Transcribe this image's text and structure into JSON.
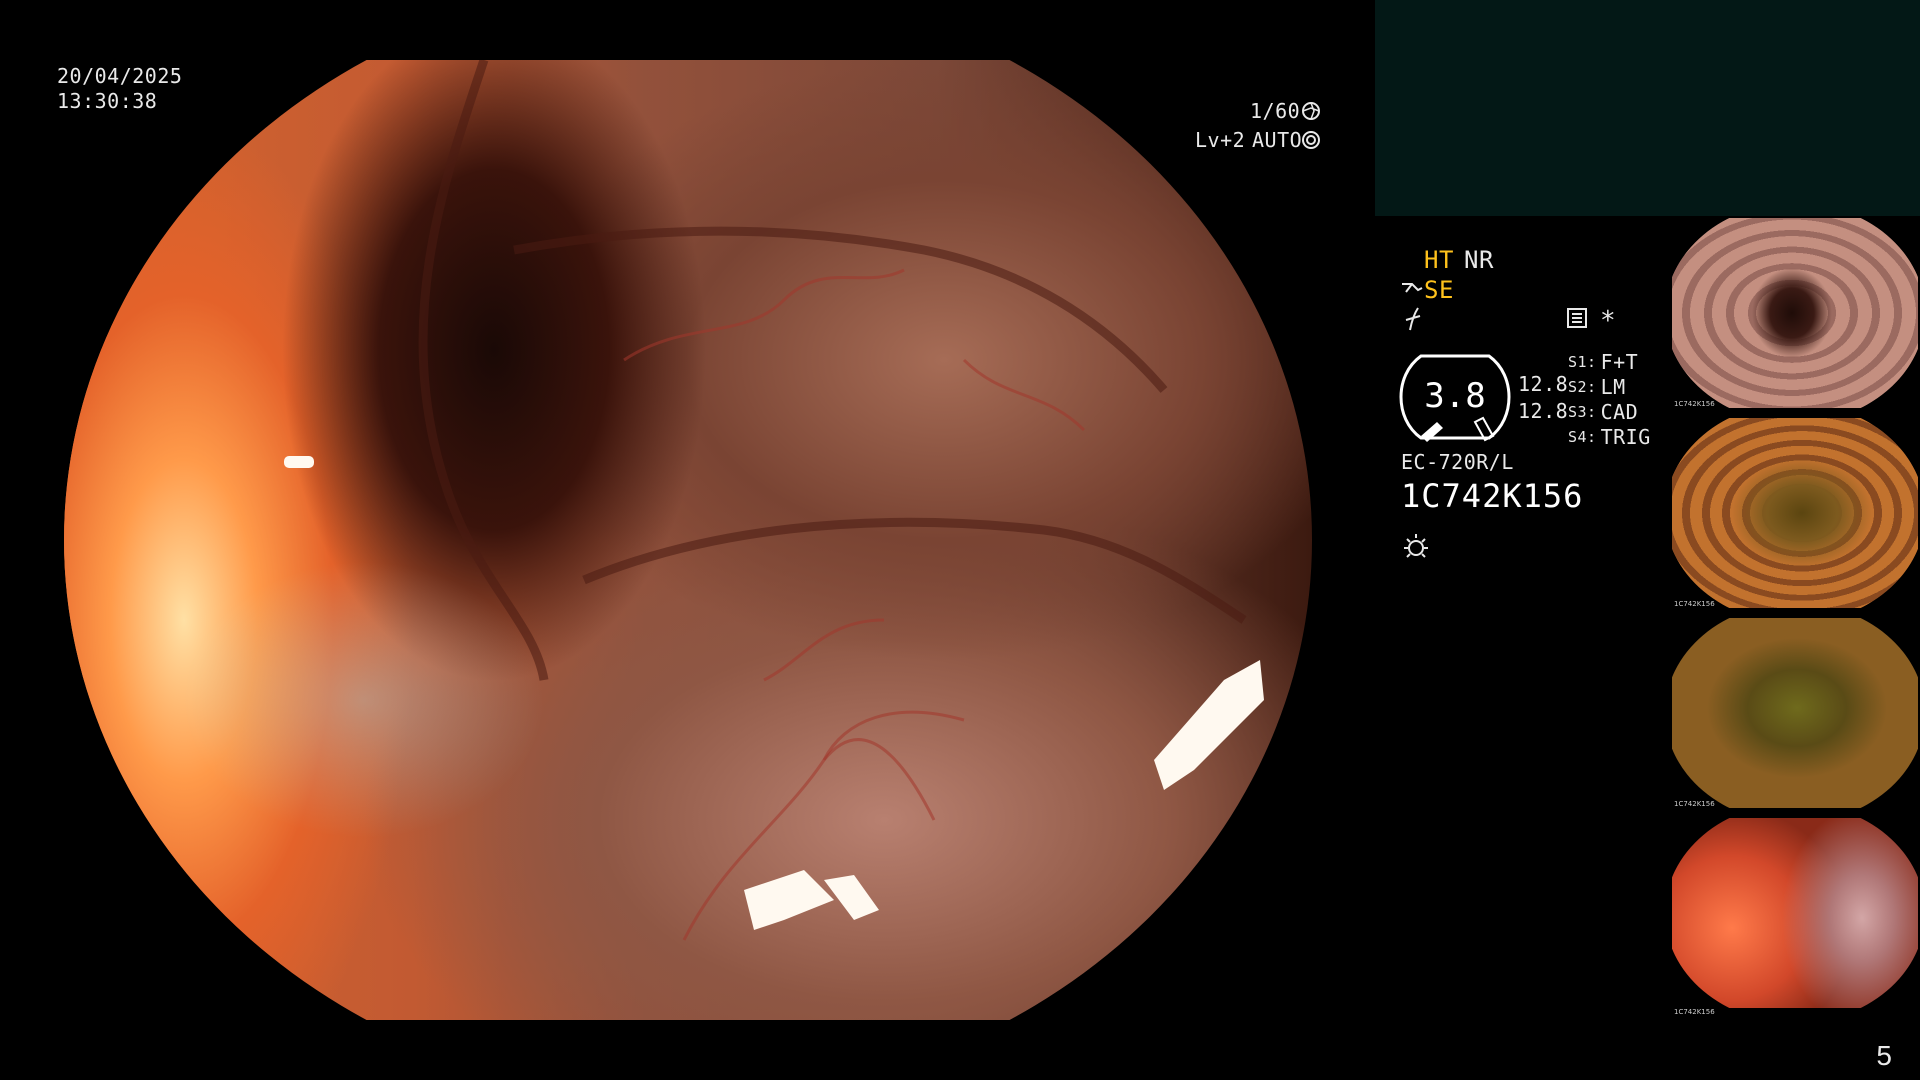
{
  "overlay": {
    "date": "20/04/2025",
    "time": "13:30:38",
    "shutter": "1/60",
    "exposure": "Lv+2",
    "mode": "AUTO"
  },
  "indicators": {
    "ht": "HT",
    "nr": "NR",
    "se": "SE",
    "dial_value": "3.8",
    "value_top": "12.8",
    "value_bottom": "12.8",
    "model": "EC-720R/L",
    "serial": "1C742K156",
    "asterisk": "*"
  },
  "switches": [
    {
      "key": "S1:",
      "value": "F+T"
    },
    {
      "key": "S2:",
      "value": "LM"
    },
    {
      "key": "S3:",
      "value": "CAD"
    },
    {
      "key": "S4:",
      "value": "TRIG"
    }
  ],
  "thumbnails": [
    {
      "serial": "1C742K156"
    },
    {
      "serial": "1C742K156"
    },
    {
      "serial": "1C742K156"
    },
    {
      "serial": "1C742K156"
    }
  ],
  "page_number": "5",
  "colors": {
    "accent_yellow": "#ffc21c",
    "panel_dark": "#031816",
    "text": "#e9e9e9"
  },
  "icons": [
    "shutter-icon",
    "auto-iris-icon",
    "tool-icon",
    "freeze-icon",
    "memory-card-icon",
    "light-icon",
    "iris-dial-icon"
  ]
}
